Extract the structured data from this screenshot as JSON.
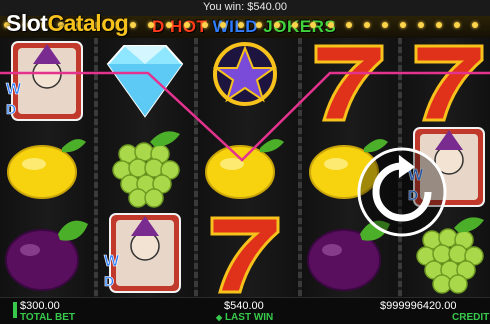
{
  "header": {
    "watermark_brand_a": "Slot",
    "watermark_brand_b": "Catalog",
    "win_text": "You win: $540.00",
    "game_title_part1": "D HOT",
    "game_title_part2": "WILD",
    "game_title_part3": "JOKERS"
  },
  "reels": [
    [
      "wild-joker-icon",
      "lemon-icon",
      "plum-icon"
    ],
    [
      "diamond-icon",
      "grapes-icon",
      "wild-joker-icon"
    ],
    [
      "star-icon",
      "lemon-icon",
      "seven-icon"
    ],
    [
      "seven-icon",
      "lemon-icon",
      "plum-icon"
    ],
    [
      "seven-icon",
      "wild-joker-icon",
      "grapes-icon"
    ]
  ],
  "winning_line": {
    "color": "#e4338f"
  },
  "footer": {
    "total_bet_value": "$300.00",
    "total_bet_label": "TOTAL BET",
    "last_win_value": "$540.00",
    "last_win_label": "LAST WIN",
    "last_win_arrow": "◆",
    "credit_value": "$999996420.00",
    "credit_label": "CREDIT"
  },
  "colors": {
    "accent_green": "#37c94b",
    "gold": "#f6c21b"
  }
}
